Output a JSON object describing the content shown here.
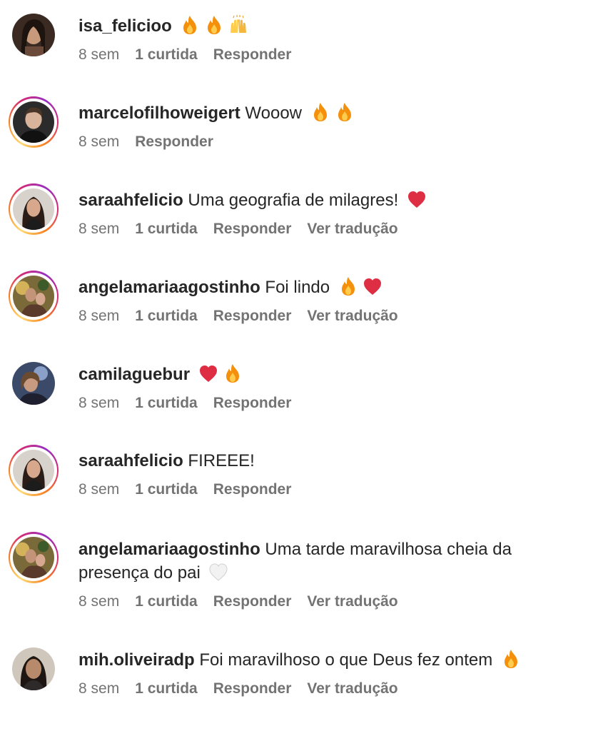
{
  "comments": [
    {
      "username": "isa_felicioo",
      "text": "",
      "emojis": [
        "fire",
        "fire",
        "raised-hands"
      ],
      "time": "8 sem",
      "likes": "1 curtida",
      "reply": "Responder",
      "translate": "",
      "story_ring": false
    },
    {
      "username": "marcelofilhoweigert",
      "text": "Wooow",
      "emojis": [
        "fire",
        "fire"
      ],
      "time": "8 sem",
      "likes": "",
      "reply": "Responder",
      "translate": "",
      "story_ring": true
    },
    {
      "username": "saraahfelicio",
      "text": "Uma geografia de milagres!",
      "emojis": [
        "red-heart"
      ],
      "time": "8 sem",
      "likes": "1 curtida",
      "reply": "Responder",
      "translate": "Ver tradução",
      "story_ring": true
    },
    {
      "username": "angelamariaagostinho",
      "text": "Foi lindo",
      "emojis": [
        "fire",
        "red-heart"
      ],
      "time": "8 sem",
      "likes": "1 curtida",
      "reply": "Responder",
      "translate": "Ver tradução",
      "story_ring": true
    },
    {
      "username": "camilaguebur",
      "text": "",
      "emojis": [
        "red-heart",
        "fire"
      ],
      "time": "8 sem",
      "likes": "1 curtida",
      "reply": "Responder",
      "translate": "",
      "story_ring": false
    },
    {
      "username": "saraahfelicio",
      "text": "FIREEE!",
      "emojis": [],
      "time": "8 sem",
      "likes": "1 curtida",
      "reply": "Responder",
      "translate": "",
      "story_ring": true
    },
    {
      "username": "angelamariaagostinho",
      "text": "Uma tarde maravilhosa cheia da presença do pai",
      "emojis": [
        "white-heart"
      ],
      "time": "8 sem",
      "likes": "1 curtida",
      "reply": "Responder",
      "translate": "Ver tradução",
      "story_ring": true
    },
    {
      "username": "mih.oliveiradp",
      "text": "Foi maravilhoso o que Deus fez ontem",
      "emojis": [
        "fire"
      ],
      "time": "8 sem",
      "likes": "1 curtida",
      "reply": "Responder",
      "translate": "Ver tradução",
      "story_ring": false
    }
  ],
  "colors": {
    "text": "#262626",
    "meta": "#737373",
    "fire": "#f4900c",
    "heart": "#dd2e44"
  }
}
